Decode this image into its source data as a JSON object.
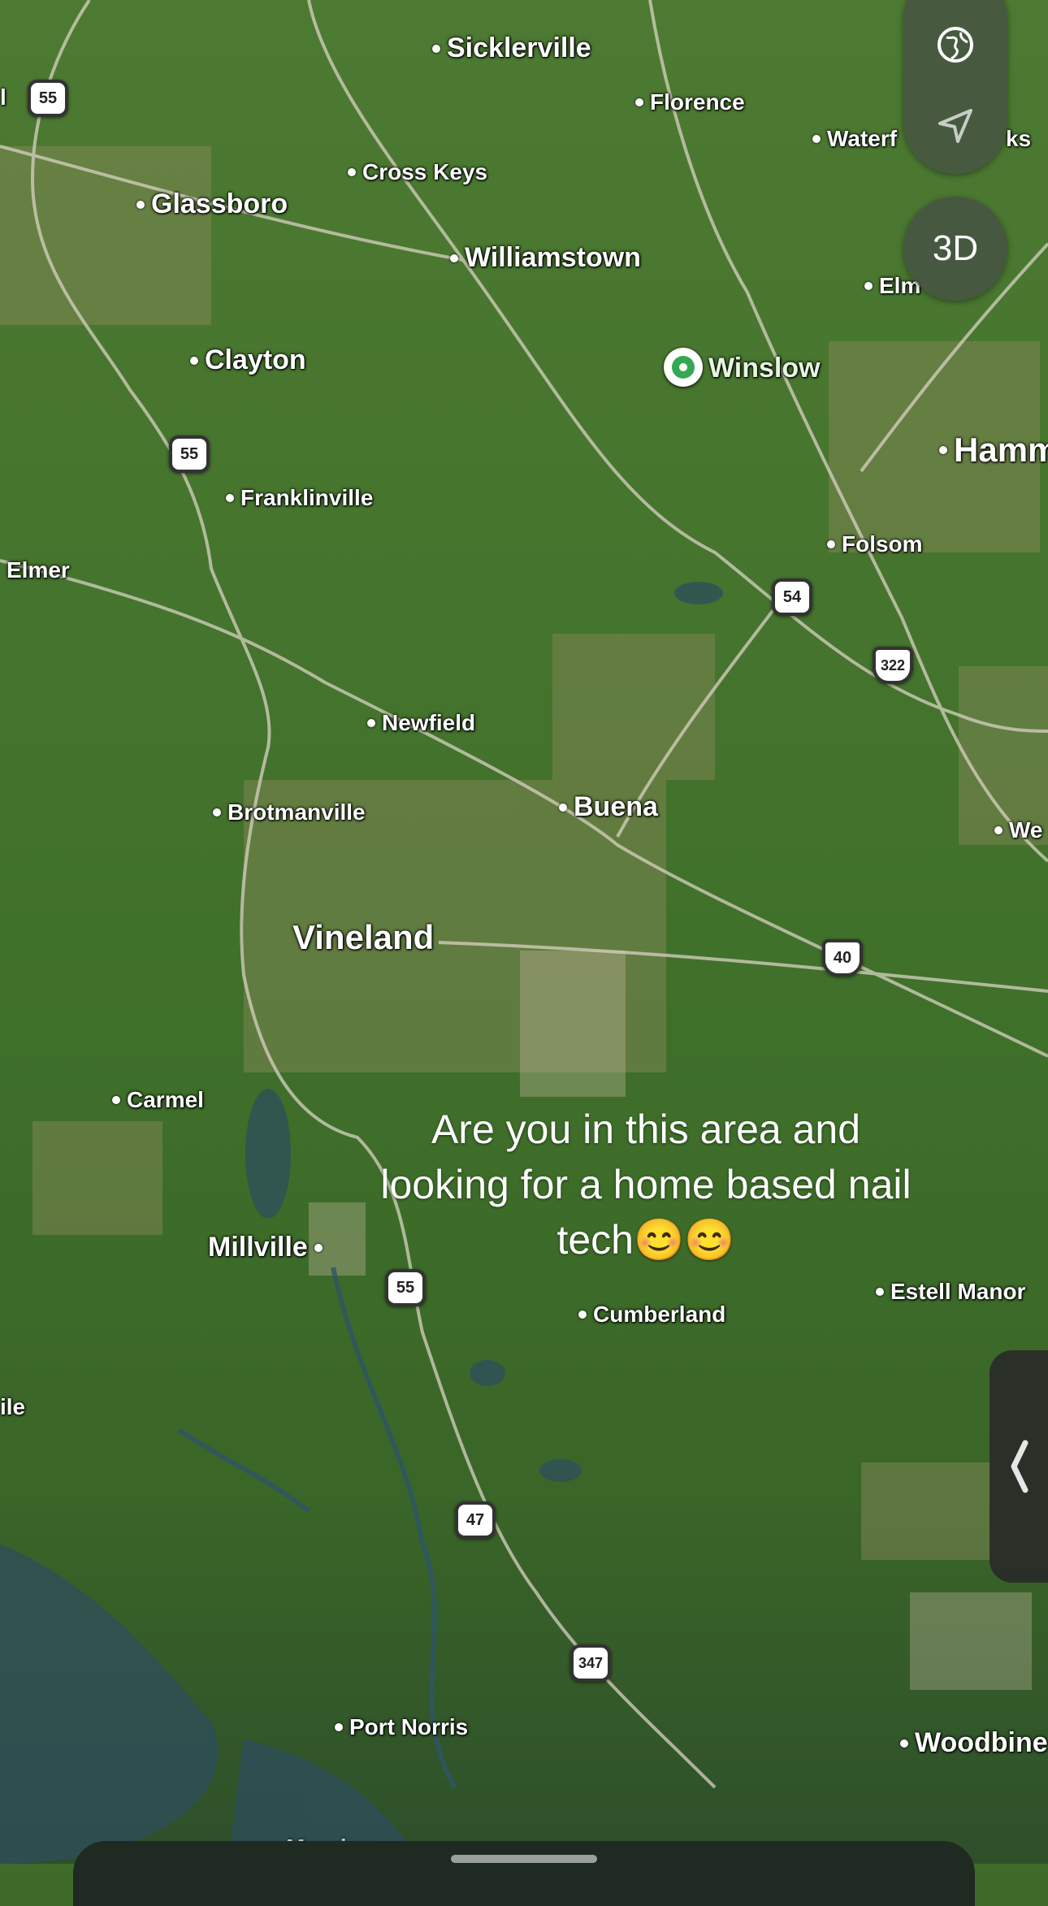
{
  "places": {
    "sicklerville": "Sicklerville",
    "florence": "Florence",
    "waterford_works": "Waterf",
    "waterford_works_tail": "ks",
    "cross_keys": "Cross Keys",
    "glassboro": "Glassboro",
    "williamstown": "Williamstown",
    "elm": "Elm",
    "clayton": "Clayton",
    "winslow": "Winslow",
    "hammonton": "Hamm",
    "franklinville": "Franklinville",
    "elmer": "Elmer",
    "folsom": "Folsom",
    "newfield": "Newfield",
    "buena": "Buena",
    "brotmanville": "Brotmanville",
    "west": "We",
    "vineland": "Vineland",
    "carmel": "Carmel",
    "millville": "Millville",
    "estell_manor": "Estell Manor",
    "cumberland": "Cumberland",
    "port_norris": "Port Norris",
    "woodbine": "Woodbine",
    "left_edge_town": "ile",
    "left_edge_top": "l",
    "maurice": "Maurice"
  },
  "shields": {
    "r55_top": "55",
    "r55_mid": "55",
    "r55_low": "55",
    "r54": "54",
    "r322": "322",
    "r40": "40",
    "r47": "47",
    "r347": "347"
  },
  "controls": {
    "globe_icon": "globe-icon",
    "location_icon": "location-arrow-icon",
    "three_d_label": "3D",
    "handle_icon": "chevron-left-icon"
  },
  "caption": {
    "line1": "Are you in this area and",
    "line2": "looking for a home based nail",
    "line3": "tech😊😊"
  },
  "colors": {
    "pin_green": "#34a853"
  }
}
